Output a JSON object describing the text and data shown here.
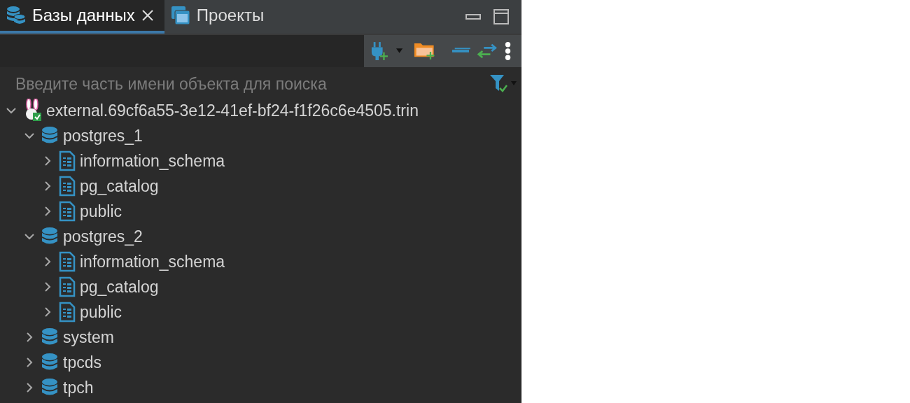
{
  "tabs": [
    {
      "label": "Базы данных",
      "selected": true,
      "kind": "databases",
      "closable": true
    },
    {
      "label": "Проекты",
      "selected": false,
      "kind": "projects",
      "closable": false
    }
  ],
  "search": {
    "placeholder": "Введите часть имени объекта для поиска"
  },
  "tree": [
    {
      "kind": "connection",
      "label": "external.69cf6a55-3e12-41ef-bf24-f1f26c6e4505.trin",
      "expanded": true,
      "children": [
        {
          "kind": "database",
          "label": "postgres_1",
          "expanded": true,
          "children": [
            {
              "kind": "schema",
              "label": "information_schema",
              "expanded": false
            },
            {
              "kind": "schema",
              "label": "pg_catalog",
              "expanded": false
            },
            {
              "kind": "schema",
              "label": "public",
              "expanded": false
            }
          ]
        },
        {
          "kind": "database",
          "label": "postgres_2",
          "expanded": true,
          "children": [
            {
              "kind": "schema",
              "label": "information_schema",
              "expanded": false
            },
            {
              "kind": "schema",
              "label": "pg_catalog",
              "expanded": false
            },
            {
              "kind": "schema",
              "label": "public",
              "expanded": false
            }
          ]
        },
        {
          "kind": "database",
          "label": "system",
          "expanded": false
        },
        {
          "kind": "database",
          "label": "tpcds",
          "expanded": false
        },
        {
          "kind": "database",
          "label": "tpch",
          "expanded": false
        }
      ]
    }
  ]
}
